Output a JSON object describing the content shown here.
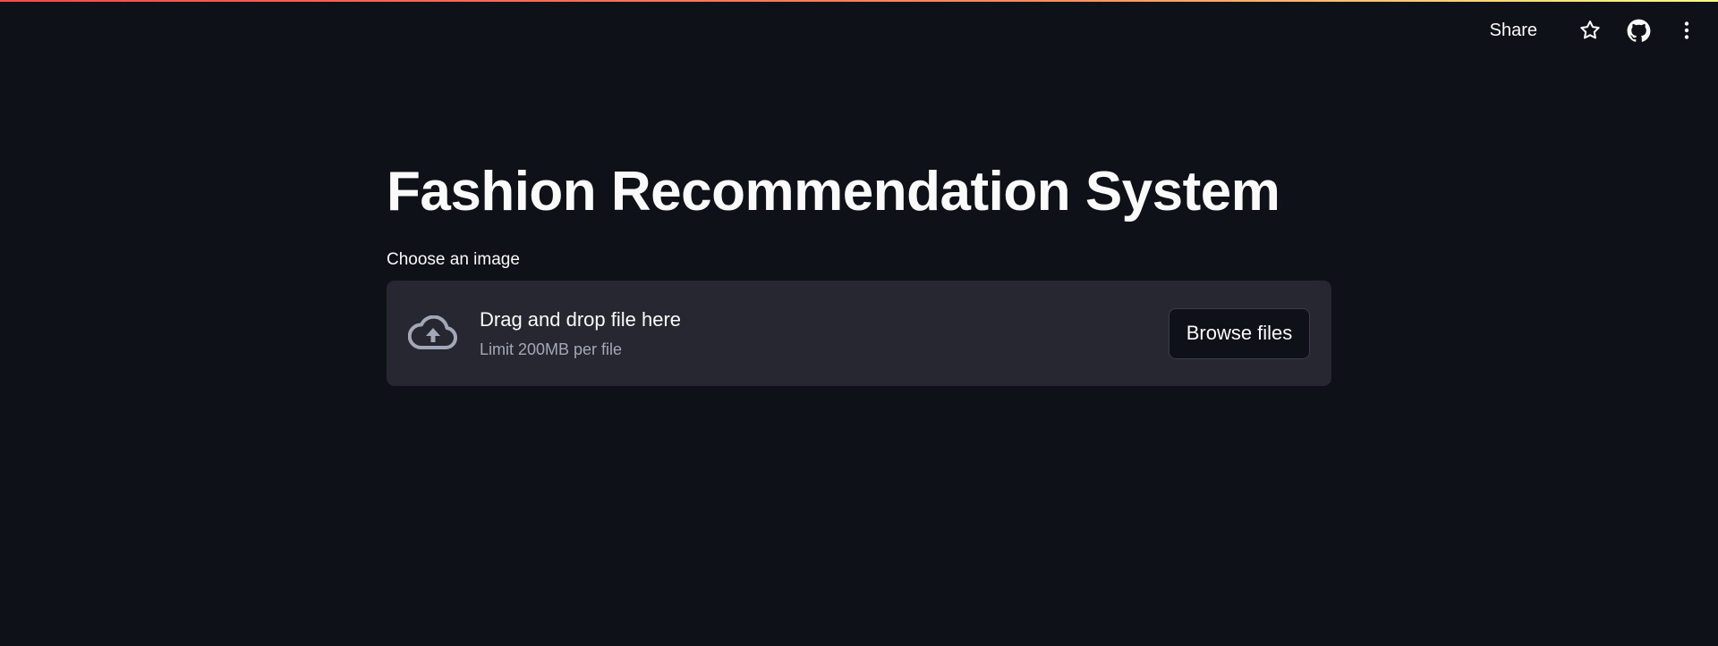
{
  "header": {
    "share_label": "Share",
    "icons": [
      "star-icon",
      "github-icon",
      "more-vertical-icon"
    ]
  },
  "main": {
    "title": "Fashion Recommendation System",
    "uploader": {
      "label": "Choose an image",
      "dropzone_title": "Drag and drop file here",
      "dropzone_limit": "Limit 200MB per file",
      "browse_label": "Browse files",
      "icon": "cloud-upload-icon"
    }
  },
  "colors": {
    "background": "#0e1117",
    "dropzone_bg": "#262730",
    "text": "#fafafa",
    "muted_text": "#a3a8b8",
    "accent_start": "#ff4b4b",
    "accent_end": "#fffd80"
  }
}
